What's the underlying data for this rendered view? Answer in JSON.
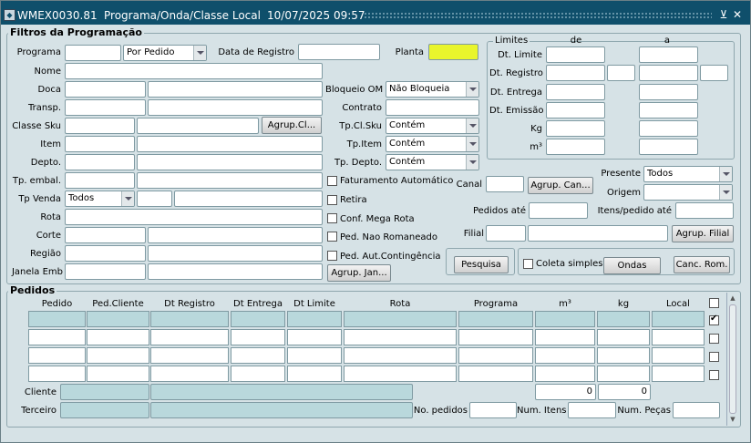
{
  "window": {
    "code": "WMEX0030.81",
    "title": "Programa/Onda/Classe Local",
    "datetime": "10/07/2025 09:57"
  },
  "filtros": {
    "legend": "Filtros da Programação",
    "programa_label": "Programa",
    "programa_value": "",
    "programa_tipo": "Por Pedido",
    "data_registro_label": "Data de Registro",
    "data_registro_value": "",
    "planta_label": "Planta",
    "planta_value": "",
    "nome_label": "Nome",
    "doca_label": "Doca",
    "transp_label": "Transp.",
    "classe_sku_label": "Classe Sku",
    "agrup_cl_button": "Agrup.Cl...",
    "item_label": "Item",
    "depto_label": "Depto.",
    "tp_embal_label": "Tp. embal.",
    "tp_venda_label": "Tp Venda",
    "tp_venda_value": "Todos",
    "rota_label": "Rota",
    "corte_label": "Corte",
    "regiao_label": "Região",
    "janela_emb_label": "Janela Emb",
    "bloqueio_om_label": "Bloqueio OM",
    "bloqueio_om_value": "Não Bloqueia",
    "contrato_label": "Contrato",
    "tp_cl_sku_label": "Tp.Cl.Sku",
    "tp_cl_sku_value": "Contém",
    "tp_item_label": "Tp.Item",
    "tp_item_value": "Contém",
    "tp_depto_label": "Tp. Depto.",
    "tp_depto_value": "Contém",
    "faturamento_automatico": "Faturamento Automático",
    "retira": "Retira",
    "conf_mega_rota": "Conf. Mega Rota",
    "ped_nao_romaneado": "Ped. Nao Romaneado",
    "ped_aut_contingencia": "Ped. Aut.Contingência",
    "agrup_jan_button": "Agrup. Jan...",
    "limites": {
      "legend": "Limites",
      "de_label": "de",
      "a_label": "a",
      "rows": [
        "Dt. Limite",
        "Dt. Registro",
        "Dt. Entrega",
        "Dt. Emissão",
        "Kg",
        "m³"
      ]
    },
    "canal_label": "Canal",
    "agrup_can_button": "Agrup. Can...",
    "presente_label": "Presente",
    "presente_value": "Todos",
    "origem_label": "Origem",
    "origem_value": "",
    "pedidos_ate_label": "Pedidos até",
    "itens_pedido_ate_label": "Itens/pedido até",
    "filial_label": "Filial",
    "agrup_filial_button": "Agrup. Filial",
    "pesquisa_button": "Pesquisa",
    "coleta_simples": "Coleta simples",
    "ondas_button": "Ondas",
    "canc_rom_button": "Canc. Rom."
  },
  "pedidos": {
    "legend": "Pedidos",
    "columns": [
      "Pedido",
      "Ped.Cliente",
      "Dt Registro",
      "Dt Entrega",
      "Dt Limite",
      "Rota",
      "Programa",
      "m³",
      "kg",
      "Local"
    ],
    "row_checks": [
      false,
      true,
      false,
      false,
      false
    ],
    "cliente_label": "Cliente",
    "terceiro_label": "Terceiro",
    "total_m3": "0",
    "total_kg": "0",
    "no_pedidos_label": "No. pedidos",
    "num_itens_label": "Num. Itens",
    "num_pecas_label": "Num. Peças"
  }
}
